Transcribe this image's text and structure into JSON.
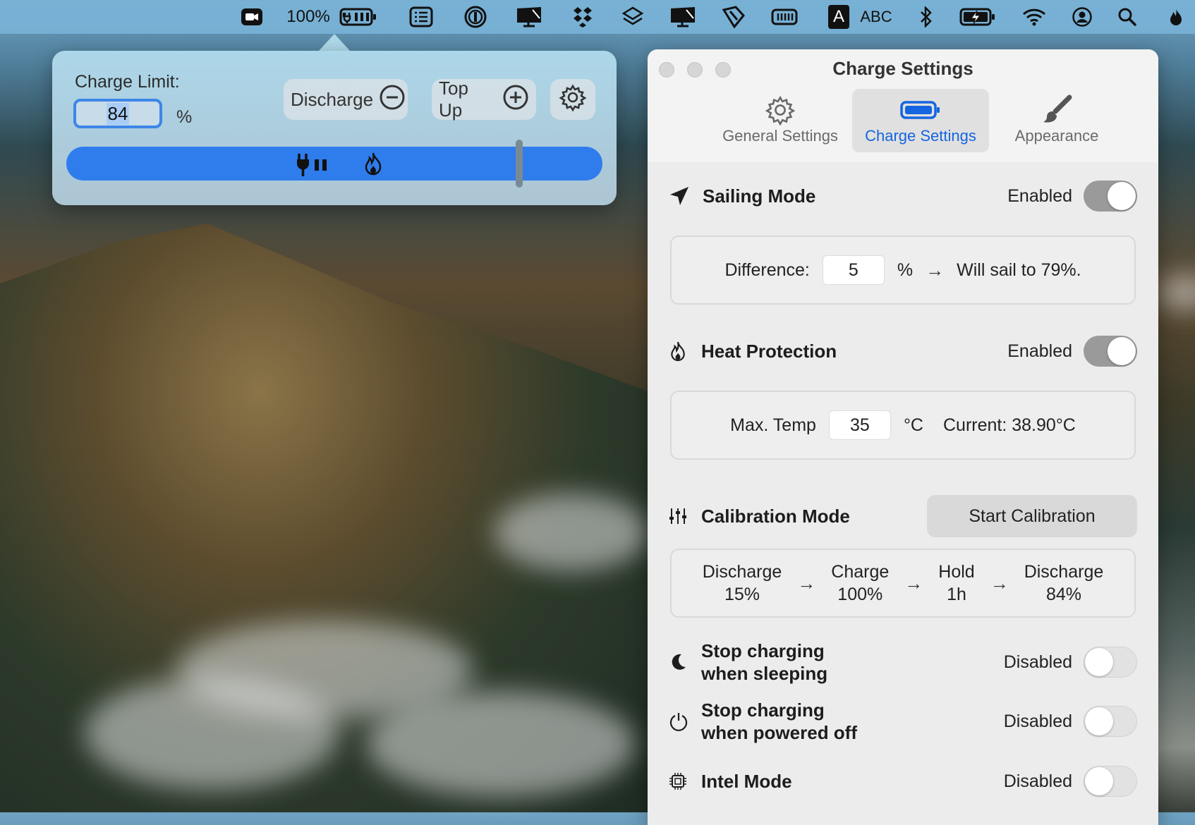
{
  "menubar": {
    "battery_percent": "100%",
    "input_source": "ABC",
    "input_letter": "A"
  },
  "popover": {
    "charge_limit_label": "Charge Limit:",
    "charge_limit_value": "84",
    "percent_sign": "%",
    "discharge_label": "Discharge",
    "top_up_label": "Top Up",
    "slider_level_percent": 84
  },
  "window": {
    "title": "Charge Settings",
    "tabs": [
      {
        "label": "General Settings"
      },
      {
        "label": "Charge Settings"
      },
      {
        "label": "Appearance"
      }
    ],
    "sailing": {
      "title": "Sailing Mode",
      "state": "Enabled",
      "difference_label": "Difference:",
      "difference_value": "5",
      "unit": "%",
      "result": "Will sail to 79%."
    },
    "heat": {
      "title": "Heat Protection",
      "state": "Enabled",
      "max_label": "Max. Temp",
      "max_value": "35",
      "unit": "°C",
      "current": "Current: 38.90°C"
    },
    "calibration": {
      "title": "Calibration Mode",
      "button": "Start Calibration",
      "steps": [
        {
          "line1": "Discharge",
          "line2": "15%"
        },
        {
          "line1": "Charge",
          "line2": "100%"
        },
        {
          "line1": "Hold",
          "line2": "1h"
        },
        {
          "line1": "Discharge",
          "line2": "84%"
        }
      ]
    },
    "sleep": {
      "line1": "Stop charging",
      "line2": "when sleeping",
      "state": "Disabled"
    },
    "poweroff": {
      "line1": "Stop charging",
      "line2": "when powered off",
      "state": "Disabled"
    },
    "intel": {
      "title": "Intel Mode",
      "state": "Disabled"
    }
  },
  "colors": {
    "accent": "#1565e0",
    "slider": "#2f7cec"
  }
}
